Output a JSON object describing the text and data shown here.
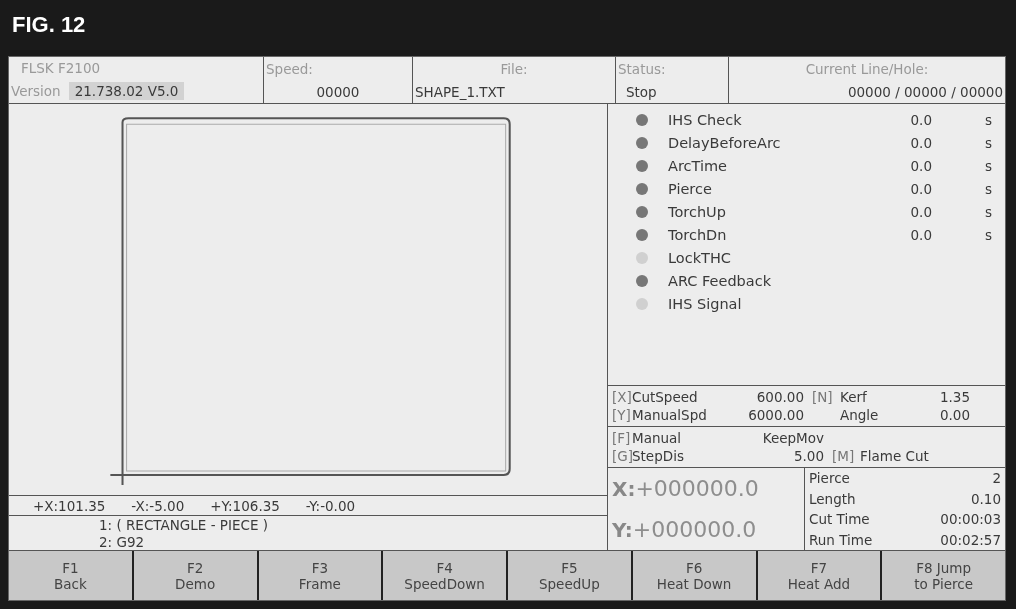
{
  "figure_label": "FIG. 12",
  "header": {
    "model": "FLSK F2100",
    "version_label": "Version",
    "version": "21.738.02 V5.0",
    "speed_label": "Speed:",
    "speed": "00000",
    "file_label": "File:",
    "file": "SHAPE_1.TXT",
    "status_label": "Status:",
    "status": "Stop",
    "line_label": "Current Line/Hole:",
    "line_value": "00000 / 00000 / 00000"
  },
  "limits": [
    "+X:101.35",
    "-X:-5.00",
    "+Y:106.35",
    "-Y:-0.00"
  ],
  "program_lines": [
    "1: ( RECTANGLE - PIECE )",
    "2: G92"
  ],
  "io": [
    {
      "label": "IHS Check",
      "on": true,
      "value": "0.0",
      "unit": "s"
    },
    {
      "label": "DelayBeforeArc",
      "on": true,
      "value": "0.0",
      "unit": "s"
    },
    {
      "label": "ArcTime",
      "on": true,
      "value": "0.0",
      "unit": "s"
    },
    {
      "label": "Pierce",
      "on": true,
      "value": "0.0",
      "unit": "s"
    },
    {
      "label": "TorchUp",
      "on": true,
      "value": "0.0",
      "unit": "s"
    },
    {
      "label": "TorchDn",
      "on": true,
      "value": "0.0",
      "unit": "s"
    },
    {
      "label": "LockTHC",
      "on": false
    },
    {
      "label": "ARC Feedback",
      "on": true
    },
    {
      "label": "IHS Signal",
      "on": false
    }
  ],
  "params": [
    {
      "key": "[X]",
      "label": "CutSpeed",
      "value": "600.00",
      "key2": "[N]",
      "label2": "Kerf",
      "value2": "1.35"
    },
    {
      "key": "[Y]",
      "label": "ManualSpd",
      "value": "6000.00",
      "label2": "Angle",
      "value2": "0.00"
    }
  ],
  "manual": [
    {
      "key": "[F]",
      "label": "Manual",
      "value": "KeepMov"
    },
    {
      "key": "[G]",
      "label": "StepDis",
      "value": "5.00",
      "key2": "[M]",
      "label2": "Flame Cut"
    }
  ],
  "coords": [
    {
      "axis": "X:",
      "value": "+000000.0"
    },
    {
      "axis": "Y:",
      "value": "+000000.0"
    }
  ],
  "stats": [
    {
      "label": "Pierce",
      "value": "2"
    },
    {
      "label": "Length",
      "value": "0.10"
    },
    {
      "label": "Cut Time",
      "value": "00:00:03"
    },
    {
      "label": "Run Time",
      "value": "00:02:57"
    }
  ],
  "keys": [
    {
      "key": "F1",
      "label": "Back"
    },
    {
      "key": "F2",
      "label": "Demo"
    },
    {
      "key": "F3",
      "label": "Frame"
    },
    {
      "key": "F4",
      "label": "SpeedDown"
    },
    {
      "key": "F5",
      "label": "SpeedUp"
    },
    {
      "key": "F6",
      "label": "Heat Down"
    },
    {
      "key": "F7",
      "label": "Heat Add"
    },
    {
      "key": "F8 Jump",
      "label": "to Pierce"
    }
  ]
}
